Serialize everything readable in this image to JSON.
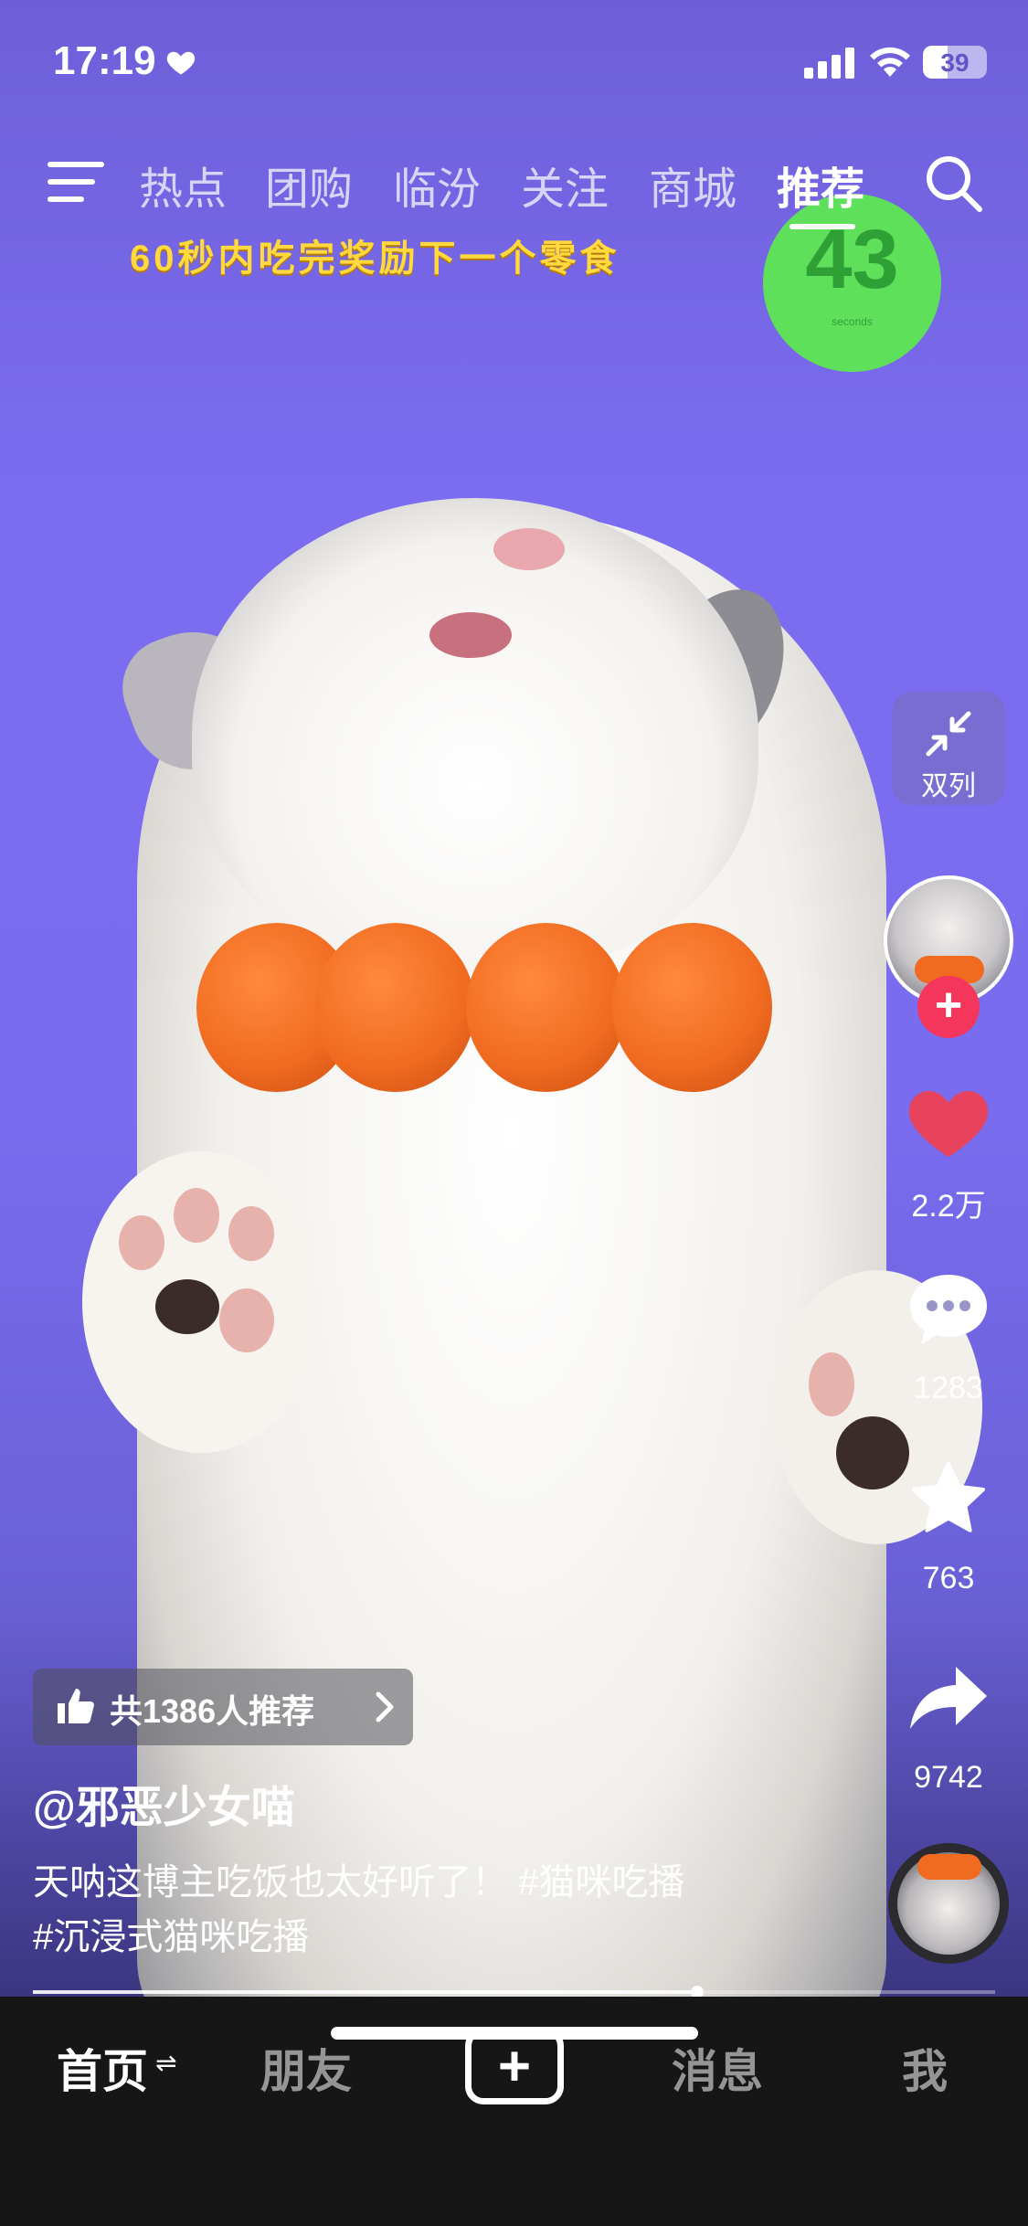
{
  "status_bar": {
    "time": "17:19",
    "battery": "39",
    "battery_level": 0.39
  },
  "top_nav": {
    "tabs": [
      {
        "label": "热点",
        "active": false
      },
      {
        "label": "团购",
        "active": false
      },
      {
        "label": "临汾",
        "active": false
      },
      {
        "label": "关注",
        "active": false
      },
      {
        "label": "商城",
        "active": false
      },
      {
        "label": "推荐",
        "active": true
      }
    ]
  },
  "video_overlay": {
    "banner": "60秒内吃完奖励下一个零食",
    "timer": "43",
    "timer_unit": "seconds"
  },
  "right_rail": {
    "dual_column_label": "双列",
    "likes": "2.2万",
    "comments": "1283",
    "favorites": "763",
    "shares": "9742"
  },
  "caption": {
    "recommend": "共1386人推荐",
    "author": "@邪恶少女喵",
    "description_line1": "天呐这博主吃饭也太好听了！ #猫咪吃播",
    "description_line2": "#沉浸式猫咪吃播"
  },
  "progress": {
    "played_fraction": 0.69
  },
  "bottom_nav": {
    "items": [
      {
        "label": "首页",
        "active": true
      },
      {
        "label": "朋友",
        "active": false
      },
      {
        "label": "消息",
        "active": false
      },
      {
        "label": "我",
        "active": false
      }
    ],
    "swap_glyph": "⇌",
    "create_glyph": "+"
  },
  "colors": {
    "accent": "#f5365c",
    "timer": "#5ee05a",
    "banner": "#ffd93d",
    "background": "#7c6cf0"
  }
}
